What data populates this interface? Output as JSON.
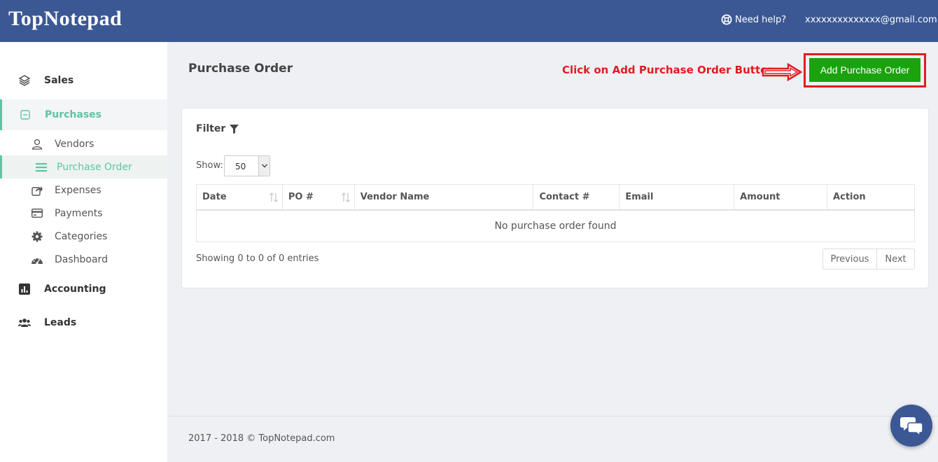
{
  "app": {
    "logo": "TopNotepad",
    "help_label": "Need help?",
    "user_email": "xxxxxxxxxxxxxx@gmail.com"
  },
  "sidebar": {
    "main": [
      {
        "label": "Sales",
        "icon": "layers-icon"
      },
      {
        "label": "Purchases",
        "icon": "minus-square-icon",
        "active": true
      },
      {
        "label": "Accounting",
        "icon": "bar-chart-icon"
      },
      {
        "label": "Leads",
        "icon": "users-icon"
      }
    ],
    "sub": [
      {
        "label": "Vendors",
        "icon": "user-outline-icon"
      },
      {
        "label": "Purchase Order",
        "icon": "list-icon",
        "active": true
      },
      {
        "label": "Expenses",
        "icon": "share-icon"
      },
      {
        "label": "Payments",
        "icon": "credit-card-icon"
      },
      {
        "label": "Categories",
        "icon": "gear-icon"
      },
      {
        "label": "Dashboard",
        "icon": "dashboard-icon"
      }
    ]
  },
  "main": {
    "title": "Purchase Order",
    "annotation": "Click on Add Purchase Order Button",
    "add_button": "Add Purchase Order",
    "filter_label": "Filter",
    "show_label": "Show:",
    "show_value": "50",
    "table": {
      "columns": [
        "Date",
        "PO #",
        "Vendor Name",
        "Contact #",
        "Email",
        "Amount",
        "Action"
      ],
      "empty_message": "No purchase order found"
    },
    "info": "Showing 0 to 0 of 0 entries",
    "pager": {
      "previous": "Previous",
      "next": "Next"
    }
  },
  "footer": {
    "text": "2017 - 2018 © TopNotepad.com"
  },
  "colors": {
    "header": "#3b5895",
    "accent": "#5ec4a6",
    "add_button": "#1aa30c",
    "annotation": "#e21b23"
  }
}
